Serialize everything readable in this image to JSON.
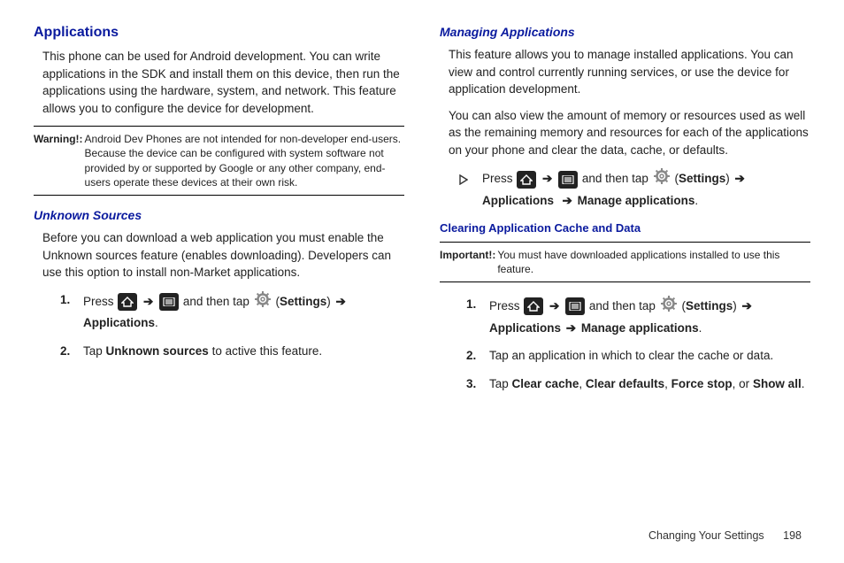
{
  "left": {
    "h_applications": "Applications",
    "p_apps_intro": "This phone can be used for Android development. You can write applications in the SDK and install them on this device, then run the applications using the hardware, system, and network. This feature allows you to configure the device for development.",
    "warning_label": "Warning!:",
    "warning_text": "Android Dev Phones are not intended for non-developer end-users. Because the device can be configured with system software not provided by or supported by Google or any other company, end-users operate these devices at their own risk.",
    "h_unknown": "Unknown Sources",
    "p_unknown": "Before you can download a web application you must enable the Unknown sources feature (enables downloading). Developers can use this option to install non-Market applications.",
    "step1_press": "Press ",
    "step1_andthentap": " and then tap ",
    "step1_settings": "Settings",
    "step1_applications": "Applications",
    "step2_tap": "Tap ",
    "step2_unknown": "Unknown sources",
    "step2_tail": " to active this feature."
  },
  "right": {
    "h_managing": "Managing Applications",
    "p_managing1": "This feature allows you to manage installed applications. You can view and control currently running services, or use the device for application development.",
    "p_managing2": "You can also view the amount of memory or resources used as well as the remaining memory and resources for each of the applications on your phone and clear the data, cache, or defaults.",
    "bullet_press": "Press ",
    "bullet_andthentap": " and then tap ",
    "bullet_settings": "Settings",
    "bullet_applications": "Applications",
    "bullet_manage": "Manage applications",
    "h_clearing": "Clearing Application Cache and Data",
    "important_label": "Important!:",
    "important_text": "You must have downloaded applications installed to use this feature.",
    "c_step1_press": "Press ",
    "c_step1_andthentap": " and then tap ",
    "c_step1_settings": "Settings",
    "c_step1_applications": "Applications",
    "c_step1_manage": "Manage applications",
    "c_step2": "Tap an application in which to clear the cache or data.",
    "c_step3_tap": "Tap ",
    "c_step3_a": "Clear cache",
    "c_step3_b": "Clear defaults",
    "c_step3_c": "Force stop",
    "c_step3_or": ", or ",
    "c_step3_d": "Show all"
  },
  "footer": {
    "section": "Changing Your Settings",
    "page": "198"
  },
  "glyphs": {
    "arrow": "➔",
    "comma": ", ",
    "period": ".",
    "lparen": " (",
    "rparen": ") "
  }
}
